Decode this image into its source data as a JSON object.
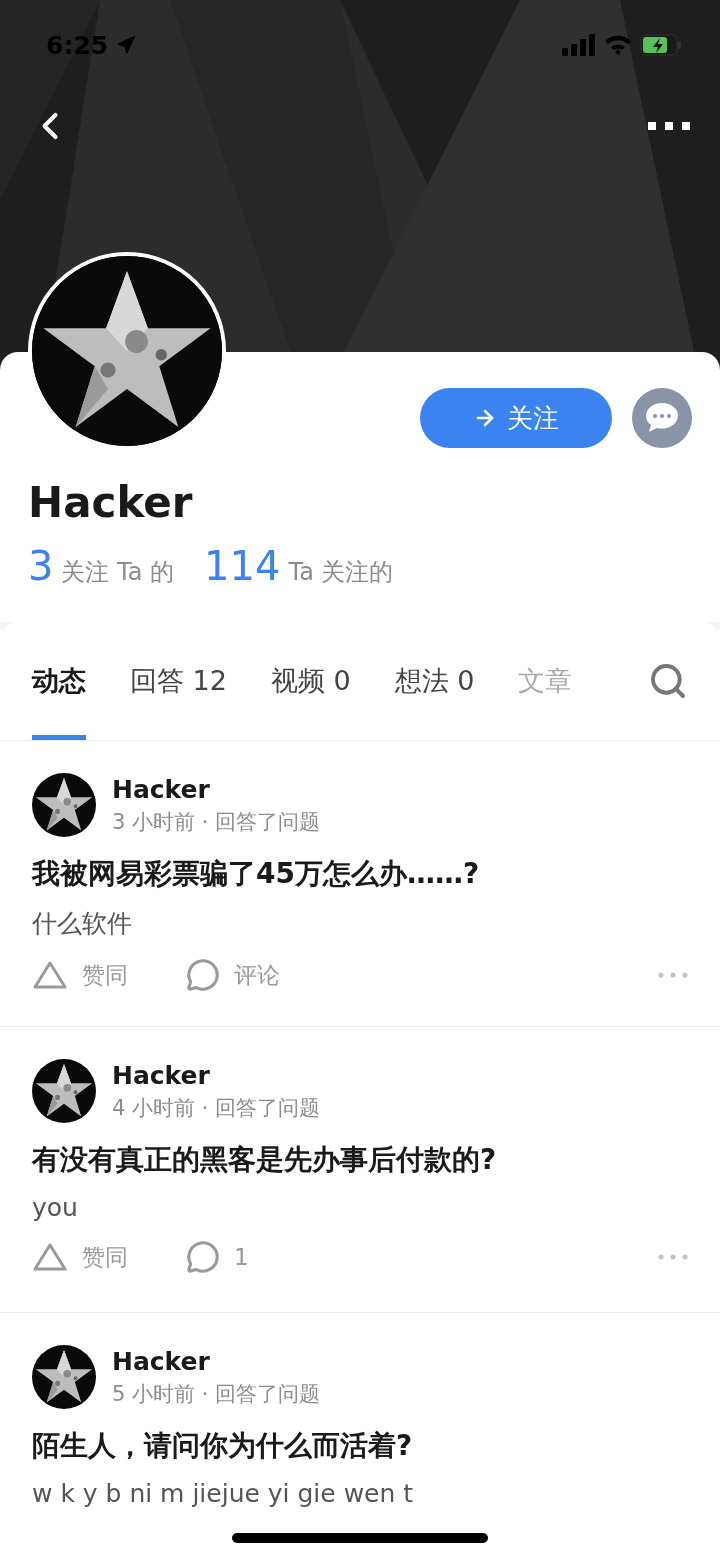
{
  "status_bar": {
    "time": "6:25"
  },
  "profile": {
    "name": "Hacker",
    "follow_label": "关注",
    "stats": [
      {
        "count": "3",
        "label": "关注 Ta 的"
      },
      {
        "count": "114",
        "label": "Ta 关注的"
      }
    ]
  },
  "tabs": [
    {
      "label": "动态",
      "selected": true
    },
    {
      "label": "回答 12",
      "selected": false
    },
    {
      "label": "视频 0",
      "selected": false
    },
    {
      "label": "想法 0",
      "selected": false
    },
    {
      "label": "文章",
      "selected": false
    }
  ],
  "feed": [
    {
      "author": "Hacker",
      "meta": "3 小时前 · 回答了问题",
      "title": "我被网易彩票骗了45万怎么办……?",
      "body": "什么软件",
      "upvote": "赞同",
      "comment": "评论"
    },
    {
      "author": "Hacker",
      "meta": "4 小时前 · 回答了问题",
      "title": "有没有真正的黑客是先办事后付款的?",
      "body": "you",
      "upvote": "赞同",
      "comment": "1"
    },
    {
      "author": "Hacker",
      "meta": "5 小时前 · 回答了问题",
      "title": "陌生人，请问你为什么而活着?",
      "body": "w k y b ni m jiejue yi gie wen t"
    }
  ]
}
